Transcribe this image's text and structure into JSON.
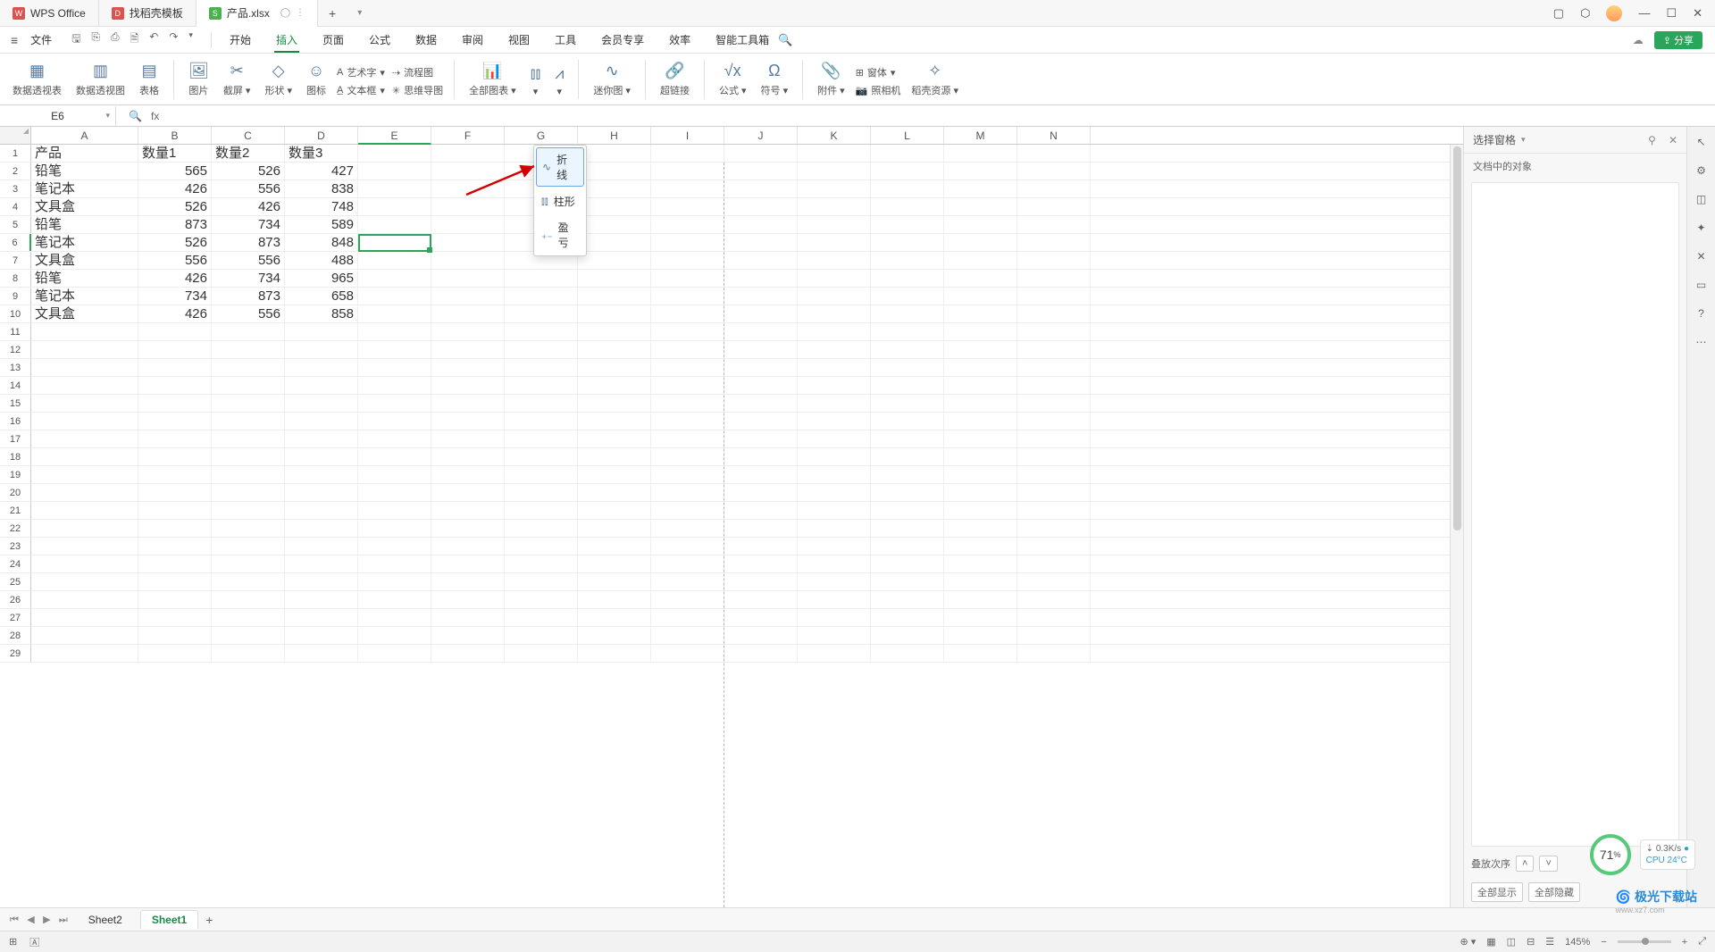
{
  "titlebar": {
    "tabs": [
      {
        "icon": "W",
        "label": "WPS Office"
      },
      {
        "icon": "D",
        "label": "找稻壳模板"
      },
      {
        "icon": "S",
        "label": "产品.xlsx"
      }
    ],
    "newtab": "+"
  },
  "menubar": {
    "file": "文件",
    "tabs": [
      "开始",
      "插入",
      "页面",
      "公式",
      "数据",
      "审阅",
      "视图",
      "工具",
      "会员专享",
      "效率",
      "智能工具箱"
    ],
    "active": "插入",
    "share": "分享"
  },
  "ribbon": {
    "items": [
      {
        "label": "数据透视表"
      },
      {
        "label": "数据透视图"
      },
      {
        "label": "表格"
      },
      {
        "label": "图片"
      },
      {
        "label": "截屏",
        "dd": true
      },
      {
        "label": "形状",
        "dd": true
      },
      {
        "label": "图标"
      },
      {
        "label": "全部图表",
        "dd": true
      },
      {
        "label": "迷你图",
        "dd": true
      },
      {
        "label": "超链接"
      },
      {
        "label": "公式",
        "dd": true
      },
      {
        "label": "符号",
        "dd": true
      },
      {
        "label": "附件",
        "dd": true
      },
      {
        "label": "照相机"
      },
      {
        "label": "稻壳资源",
        "dd": true
      }
    ],
    "split_a": [
      {
        "label": "艺术字",
        "dd": true
      },
      {
        "label": "文本框",
        "dd": true
      }
    ],
    "split_b": [
      {
        "label": "流程图"
      },
      {
        "label": "思维导图"
      }
    ],
    "split_c": [
      {
        "label": "窗体",
        "dd": true
      }
    ]
  },
  "fbar": {
    "name": "E6",
    "fx": "fx"
  },
  "sheet": {
    "cols": [
      "A",
      "B",
      "C",
      "D",
      "E",
      "F",
      "G",
      "H",
      "I",
      "J",
      "K",
      "L",
      "M",
      "N"
    ],
    "headers": [
      "产品",
      "数量1",
      "数量2",
      "数量3"
    ],
    "rows": [
      {
        "p": "铅笔",
        "q1": 565,
        "q2": 526,
        "q3": 427
      },
      {
        "p": "笔记本",
        "q1": 426,
        "q2": 556,
        "q3": 838
      },
      {
        "p": "文具盒",
        "q1": 526,
        "q2": 426,
        "q3": 748
      },
      {
        "p": "铅笔",
        "q1": 873,
        "q2": 734,
        "q3": 589
      },
      {
        "p": "笔记本",
        "q1": 526,
        "q2": 873,
        "q3": 848
      },
      {
        "p": "文具盒",
        "q1": 556,
        "q2": 556,
        "q3": 488
      },
      {
        "p": "铅笔",
        "q1": 426,
        "q2": 734,
        "q3": 965
      },
      {
        "p": "笔记本",
        "q1": 734,
        "q2": 873,
        "q3": 658
      },
      {
        "p": "文具盒",
        "q1": 426,
        "q2": 556,
        "q3": 858
      }
    ],
    "selected": {
      "row": 6,
      "col": "E"
    }
  },
  "dropdown": {
    "items": [
      {
        "icon": "折",
        "label": "折线"
      },
      {
        "icon": "柱",
        "label": "柱形"
      },
      {
        "icon": "盈",
        "label": "盈亏"
      }
    ]
  },
  "sidepanel": {
    "title": "选择窗格",
    "subtitle": "文档中的对象",
    "stackorder": "叠放次序",
    "showall": "全部显示",
    "hideall": "全部隐藏"
  },
  "sheettabs": {
    "tabs": [
      "Sheet2",
      "Sheet1"
    ],
    "active": "Sheet1",
    "add": "+"
  },
  "status": {
    "zoom": "145%",
    "circle": "71",
    "circle_unit": "%",
    "net": "0.3K/s",
    "cpu": "CPU 24°C"
  },
  "logo": {
    "name": "极光下载站",
    "url": "www.xz7.com"
  }
}
